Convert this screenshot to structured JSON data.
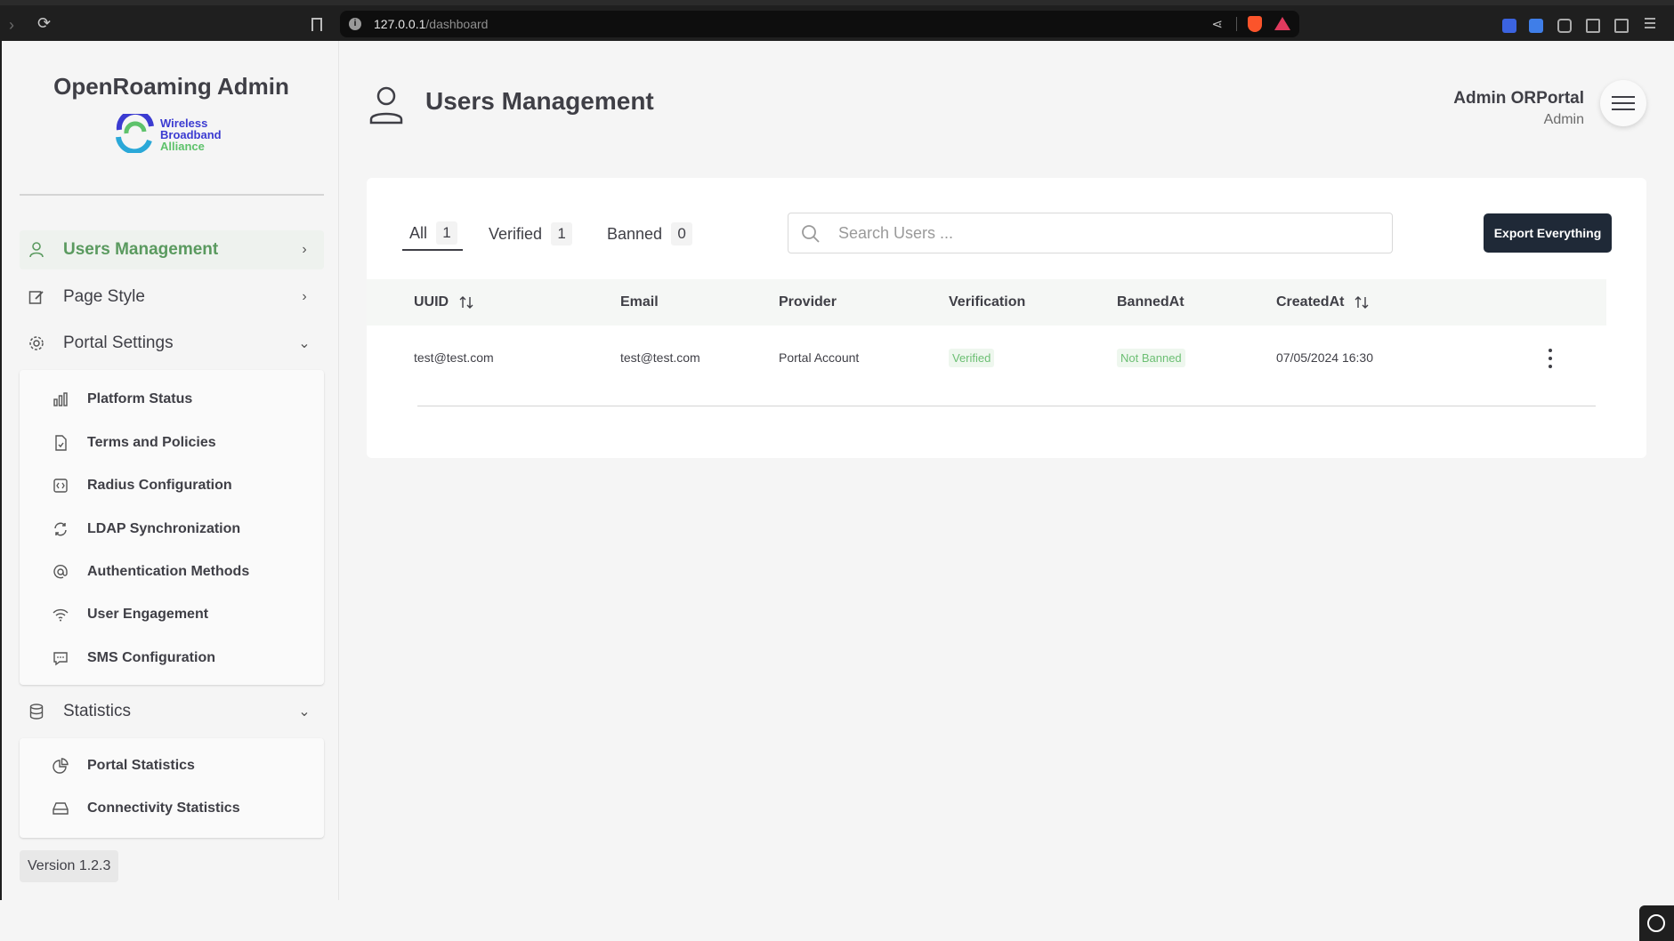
{
  "browser": {
    "url_host": "127.0.0.1",
    "url_path": "/dashboard"
  },
  "sidebar": {
    "brand_title": "OpenRoaming Admin",
    "logo_lines": [
      "Wireless",
      "Broadband",
      "Alliance"
    ],
    "items": [
      {
        "label": "Users Management",
        "icon": "user-icon",
        "active": true
      },
      {
        "label": "Page Style",
        "icon": "edit-icon"
      },
      {
        "label": "Portal Settings",
        "icon": "gear-icon",
        "expanded": true
      },
      {
        "label": "Statistics",
        "icon": "database-icon",
        "expanded": true
      }
    ],
    "portal_settings": [
      {
        "label": "Platform Status",
        "icon": "bar-chart-icon"
      },
      {
        "label": "Terms and Policies",
        "icon": "document-icon"
      },
      {
        "label": "Radius Configuration",
        "icon": "code-icon"
      },
      {
        "label": "LDAP Synchronization",
        "icon": "sync-icon"
      },
      {
        "label": "Authentication Methods",
        "icon": "at-icon"
      },
      {
        "label": "User Engagement",
        "icon": "wifi-icon"
      },
      {
        "label": "SMS Configuration",
        "icon": "chat-icon"
      }
    ],
    "statistics": [
      {
        "label": "Portal Statistics",
        "icon": "pie-chart-icon"
      },
      {
        "label": "Connectivity Statistics",
        "icon": "drive-icon"
      }
    ],
    "version": "Version 1.2.3"
  },
  "header": {
    "title": "Users Management",
    "user_name": "Admin ORPortal",
    "user_role": "Admin"
  },
  "tabs": [
    {
      "label": "All",
      "count": "1",
      "active": true
    },
    {
      "label": "Verified",
      "count": "1"
    },
    {
      "label": "Banned",
      "count": "0"
    }
  ],
  "search": {
    "placeholder": "Search Users ..."
  },
  "export_label": "Export Everything",
  "table": {
    "columns": [
      "UUID",
      "Email",
      "Provider",
      "Verification",
      "BannedAt",
      "CreatedAt"
    ],
    "rows": [
      {
        "uuid": "test@test.com",
        "email": "test@test.com",
        "provider": "Portal Account",
        "verification": "Verified",
        "banned_at": "Not Banned",
        "created_at": "07/05/2024 16:30"
      }
    ]
  },
  "colors": {
    "accent_green": "#5a9a5f",
    "badge_green": "#6cbf73",
    "dark_button": "#1f2937"
  }
}
